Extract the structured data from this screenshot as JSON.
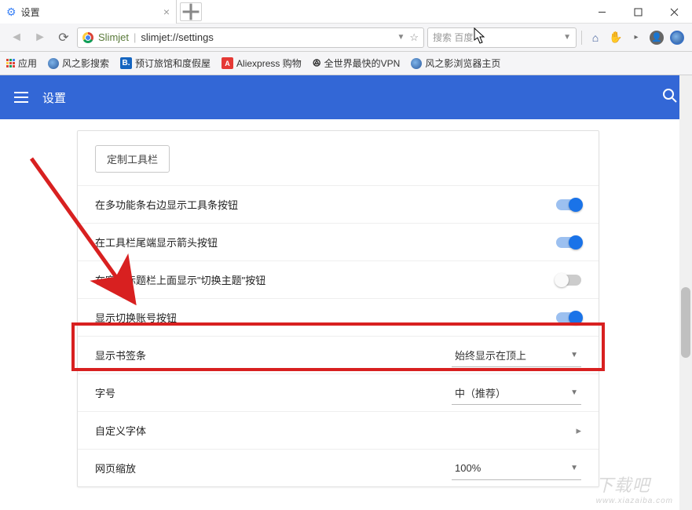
{
  "tab": {
    "title": "设置"
  },
  "toolbar": {
    "brand": "Slimjet",
    "url": "slimjet://settings",
    "search_placeholder": "搜索 百度"
  },
  "bookmarks": {
    "apps": "应用",
    "items": [
      "风之影搜索",
      "预订旅馆和度假屋",
      "Aliexpress 购物",
      "全世界最快的VPN",
      "风之影浏览器主页"
    ]
  },
  "page": {
    "title": "设置",
    "customize_button": "定制工具栏"
  },
  "rows": {
    "r1": {
      "label": "在多功能条右边显示工具条按钮",
      "toggle": true
    },
    "r2": {
      "label": "在工具栏尾端显示箭头按钮",
      "toggle": true
    },
    "r3": {
      "label": "在窗口标题栏上面显示\"切换主题\"按钮",
      "toggle": false
    },
    "r4": {
      "label": "显示切换账号按钮",
      "toggle": true
    },
    "r5": {
      "label": "显示书签条",
      "value": "始终显示在顶上"
    },
    "r6": {
      "label": "字号",
      "value": "中（推荐）"
    },
    "r7": {
      "label": "自定义字体"
    },
    "r8": {
      "label": "网页缩放",
      "value": "100%"
    }
  },
  "watermark": {
    "big": "下载吧",
    "small": "www.xiazaiba.com"
  }
}
